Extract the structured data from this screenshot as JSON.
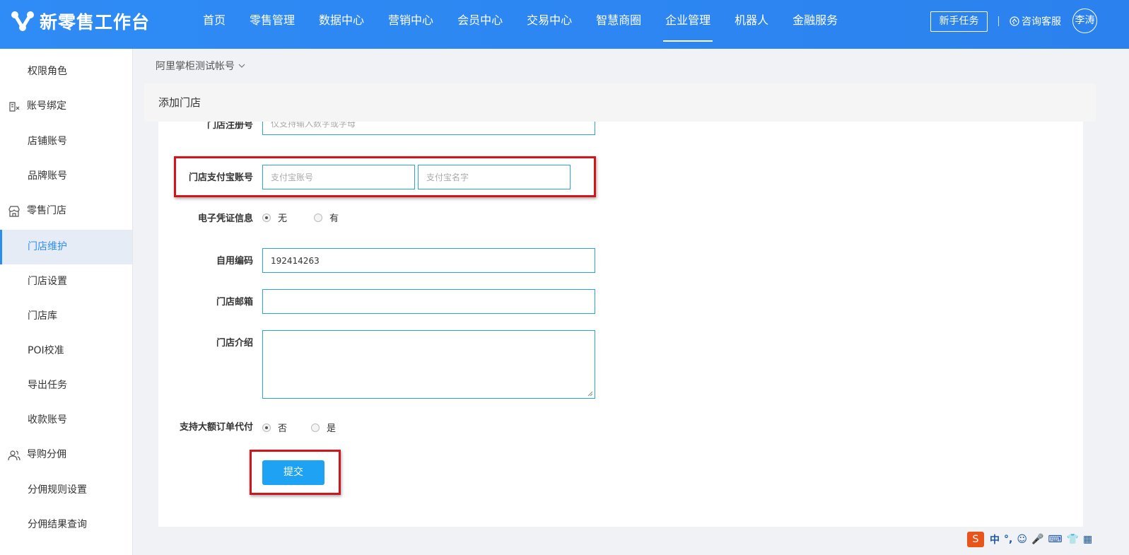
{
  "app": {
    "logo_text": "新零售工作台",
    "nav": [
      "首页",
      "零售管理",
      "数据中心",
      "营销中心",
      "会员中心",
      "交易中心",
      "智慧商圈",
      "企业管理",
      "机器人",
      "金融服务"
    ],
    "nav_active_index": 7,
    "newbie_button": "新手任务",
    "service_label": "咨询客服",
    "user_avatar": "李涛",
    "brand_color": "#2d8cf0"
  },
  "sidebar": {
    "items": [
      {
        "label": "权限角色",
        "type": "sub"
      },
      {
        "label": "账号绑定",
        "type": "group",
        "icon": "account-binding-icon"
      },
      {
        "label": "店铺账号",
        "type": "sub"
      },
      {
        "label": "品牌账号",
        "type": "sub"
      },
      {
        "label": "零售门店",
        "type": "group",
        "icon": "store-icon"
      },
      {
        "label": "门店维护",
        "type": "sub",
        "active": true
      },
      {
        "label": "门店设置",
        "type": "sub"
      },
      {
        "label": "门店库",
        "type": "sub"
      },
      {
        "label": "POI校准",
        "type": "sub"
      },
      {
        "label": "导出任务",
        "type": "sub"
      },
      {
        "label": "收款账号",
        "type": "sub"
      },
      {
        "label": "导购分佣",
        "type": "group",
        "icon": "users-icon"
      },
      {
        "label": "分佣规则设置",
        "type": "sub"
      },
      {
        "label": "分佣结果查询",
        "type": "sub"
      }
    ]
  },
  "breadcrumb": {
    "account": "阿里掌柜测试帐号"
  },
  "panel": {
    "title": "添加门店"
  },
  "form": {
    "reg_no": {
      "label": "门店注册号",
      "placeholder": "仅支持输入数字或字母"
    },
    "alipay": {
      "label": "门店支付宝账号",
      "account_placeholder": "支付宝账号",
      "name_placeholder": "支付宝名字"
    },
    "voucher": {
      "label": "电子凭证信息",
      "options": [
        "无",
        "有"
      ],
      "selected": "无"
    },
    "own_code": {
      "label": "自用编码",
      "value": "192414263"
    },
    "email": {
      "label": "门店邮箱",
      "value": ""
    },
    "intro": {
      "label": "门店介绍",
      "value": ""
    },
    "bulk_pay": {
      "label": "支持大额订单代付",
      "options": [
        "否",
        "是"
      ],
      "selected": "否"
    },
    "submit_label": "提交"
  },
  "highlight_color": "#d0161b",
  "ime": {
    "items": [
      "中",
      "°,",
      "☺",
      "🎤",
      "⌨",
      "👕",
      "▦"
    ]
  }
}
